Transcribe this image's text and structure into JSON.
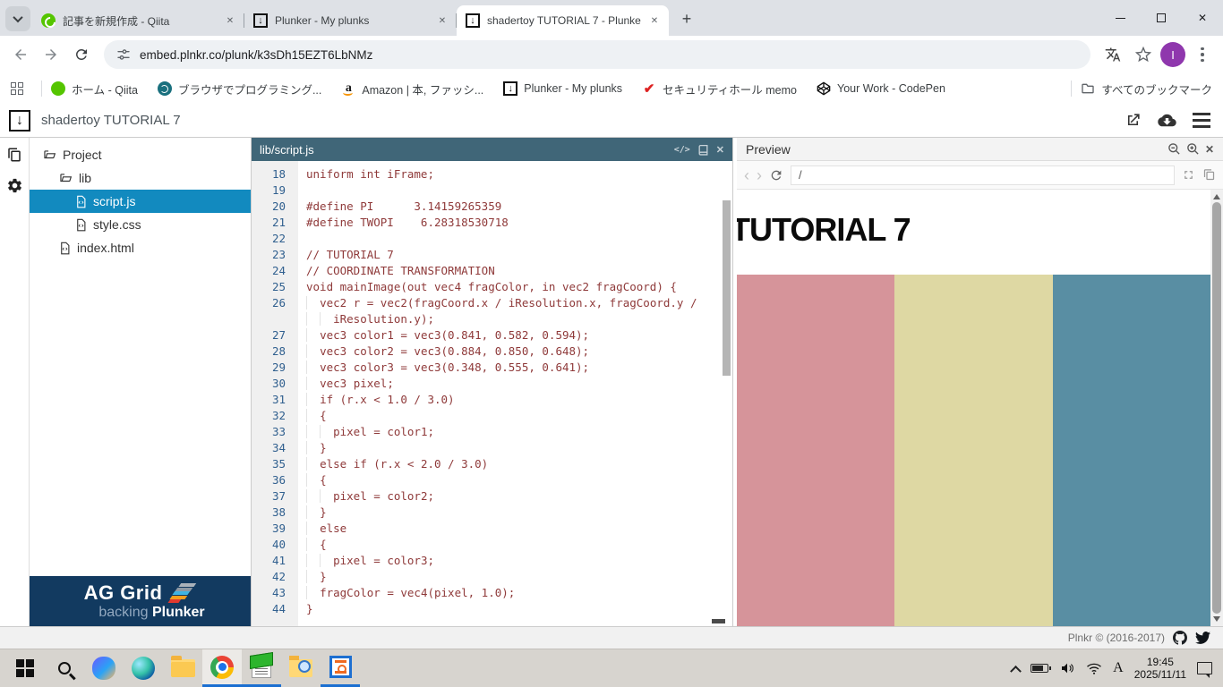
{
  "glyphs": {
    "close": "✕",
    "plus": "+",
    "nav_back": "‹",
    "nav_forward": "›",
    "code_tag": "</>",
    "down_arrow": "↓",
    "security_check": "✔"
  },
  "browser": {
    "tabs": [
      {
        "title": "記事を新規作成 - Qiita",
        "icon": "qiita",
        "active": false
      },
      {
        "title": "Plunker - My plunks",
        "icon": "plunker",
        "active": false
      },
      {
        "title": "shadertoy TUTORIAL 7 - Plunke",
        "icon": "plunker",
        "active": true
      }
    ],
    "url": "embed.plnkr.co/plunk/k3sDh15EZT6LbNMz",
    "profile_letter": "I",
    "bookmarks": [
      {
        "label": "ホーム - Qiita",
        "icon": "qiita"
      },
      {
        "label": "ブラウザでプログラミング...",
        "icon": "browser-programming"
      },
      {
        "label": "Amazon | 本, ファッシ...",
        "icon": "amazon"
      },
      {
        "label": "Plunker - My plunks",
        "icon": "plunker"
      },
      {
        "label": "セキュリティホール memo",
        "icon": "security-memo"
      },
      {
        "label": "Your Work - CodePen",
        "icon": "codepen"
      }
    ],
    "all_bookmarks_label": "すべてのブックマーク"
  },
  "plunker": {
    "title": "shadertoy TUTORIAL 7",
    "tree": [
      {
        "label": "Project",
        "type": "folder",
        "level": 0,
        "selected": false
      },
      {
        "label": "lib",
        "type": "folder",
        "level": 1,
        "selected": false
      },
      {
        "label": "script.js",
        "type": "file",
        "level": 2,
        "selected": true
      },
      {
        "label": "style.css",
        "type": "file",
        "level": 2,
        "selected": false
      },
      {
        "label": "index.html",
        "type": "file",
        "level": 1,
        "selected": false
      }
    ],
    "ad": {
      "line1": "AG Grid",
      "line2_light": "backing",
      "line2_bold": "Plunker"
    },
    "editor": {
      "filename": "lib/script.js",
      "code_color": "#8f3a3a",
      "gutter_color": "#31608f",
      "lines": [
        {
          "n": "18",
          "t": "uniform int iFrame;"
        },
        {
          "n": "19",
          "t": ""
        },
        {
          "n": "20",
          "t": "#define PI      3.14159265359"
        },
        {
          "n": "21",
          "t": "#define TWOPI    6.28318530718"
        },
        {
          "n": "22",
          "t": ""
        },
        {
          "n": "23",
          "t": "// TUTORIAL 7"
        },
        {
          "n": "24",
          "t": "// COORDINATE TRANSFORMATION"
        },
        {
          "n": "25",
          "t": "void mainImage(out vec4 fragColor, in vec2 fragCoord) {"
        },
        {
          "n": "26",
          "t": "  vec2 r = vec2(fragCoord.x / iResolution.x, fragCoord.y /"
        },
        {
          "n": "",
          "t": "    iResolution.y);"
        },
        {
          "n": "27",
          "t": "  vec3 color1 = vec3(0.841, 0.582, 0.594);"
        },
        {
          "n": "28",
          "t": "  vec3 color2 = vec3(0.884, 0.850, 0.648);"
        },
        {
          "n": "29",
          "t": "  vec3 color3 = vec3(0.348, 0.555, 0.641);"
        },
        {
          "n": "30",
          "t": "  vec3 pixel;"
        },
        {
          "n": "31",
          "t": "  if (r.x < 1.0 / 3.0)"
        },
        {
          "n": "32",
          "t": "  {"
        },
        {
          "n": "33",
          "t": "    pixel = color1;"
        },
        {
          "n": "34",
          "t": "  }"
        },
        {
          "n": "35",
          "t": "  else if (r.x < 2.0 / 3.0)"
        },
        {
          "n": "36",
          "t": "  {"
        },
        {
          "n": "37",
          "t": "    pixel = color2;"
        },
        {
          "n": "38",
          "t": "  }"
        },
        {
          "n": "39",
          "t": "  else"
        },
        {
          "n": "40",
          "t": "  {"
        },
        {
          "n": "41",
          "t": "    pixel = color3;"
        },
        {
          "n": "42",
          "t": "  }"
        },
        {
          "n": "43",
          "t": "  fragColor = vec4(pixel, 1.0);"
        },
        {
          "n": "44",
          "t": "}"
        }
      ]
    },
    "preview": {
      "title": "Preview",
      "path": "/",
      "heading": "TUTORIAL 7",
      "columns": [
        {
          "name": "color1",
          "hex": "#d6949a"
        },
        {
          "name": "color2",
          "hex": "#ded8a3"
        },
        {
          "name": "color3",
          "hex": "#598ea3"
        }
      ]
    },
    "footer": "Plnkr © (2016-2017)"
  },
  "taskbar": {
    "time": "19:45",
    "date": "2025/11/11",
    "ime": "A"
  }
}
